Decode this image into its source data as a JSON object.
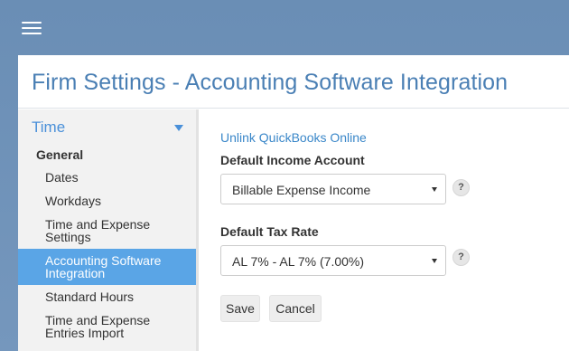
{
  "header": {
    "menu_icon": "hamburger-icon"
  },
  "panel": {
    "title": "Firm Settings - Accounting Software Integration"
  },
  "sidebar": {
    "section": "Time",
    "group": "General",
    "items": [
      {
        "label": "Dates"
      },
      {
        "label": "Workdays"
      },
      {
        "label": "Time and Expense Settings"
      },
      {
        "label": "Accounting Software Integration",
        "active": true
      },
      {
        "label": "Standard Hours"
      },
      {
        "label": "Time and Expense Entries Import"
      }
    ]
  },
  "content": {
    "unlink_label": "Unlink QuickBooks Online",
    "income": {
      "label": "Default Income Account",
      "value": "Billable Expense Income"
    },
    "tax": {
      "label": "Default Tax Rate",
      "value": "AL 7% - AL 7% (7.00%)"
    },
    "help_glyph": "?",
    "save_label": "Save",
    "cancel_label": "Cancel"
  },
  "colors": {
    "accent": "#4a7fb4",
    "active_item": "#5aa5e6",
    "link": "#3a87c9"
  }
}
